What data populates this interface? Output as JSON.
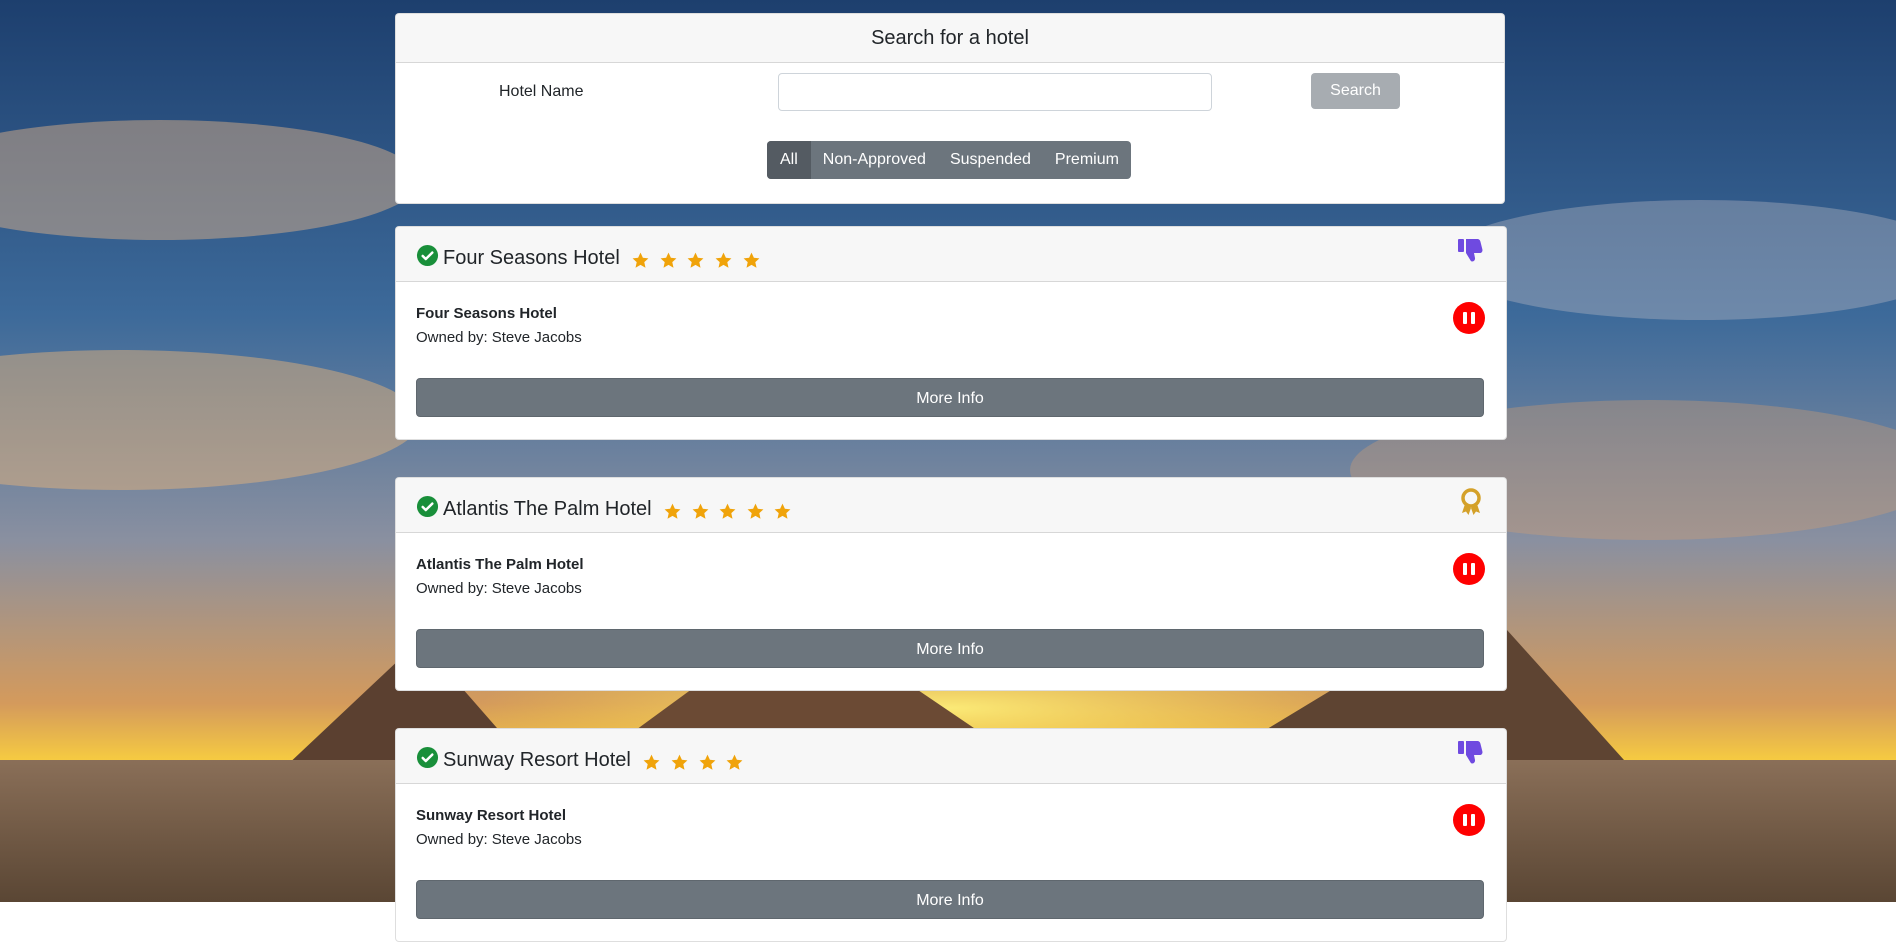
{
  "search": {
    "title": "Search for a hotel",
    "hotel_name_label": "Hotel Name",
    "hotel_name_value": "",
    "hotel_name_placeholder": "",
    "search_button": "Search",
    "filters": [
      "All",
      "Non-Approved",
      "Suspended",
      "Premium"
    ],
    "active_filter": "All"
  },
  "hotels": [
    {
      "title": "Four Seasons Hotel",
      "stars": 5,
      "approved": true,
      "badge": "thumbs-down-icon",
      "name": "Four Seasons Hotel",
      "owned_by_label": "Owned by:",
      "owner": "Steve Jacobs",
      "more_info": "More Info"
    },
    {
      "title": "Atlantis The Palm Hotel",
      "stars": 5,
      "approved": true,
      "badge": "premium-ribbon-icon",
      "name": "Atlantis The Palm Hotel",
      "owned_by_label": "Owned by:",
      "owner": "Steve Jacobs",
      "more_info": "More Info"
    },
    {
      "title": "Sunway Resort Hotel",
      "stars": 4,
      "approved": true,
      "badge": "thumbs-down-icon",
      "name": "Sunway Resort Hotel",
      "owned_by_label": "Owned by:",
      "owner": "Steve Jacobs",
      "more_info": "More Info"
    }
  ],
  "colors": {
    "check": "#198f3a",
    "star": "#f0a30a",
    "thumbs_down": "#6f4ae0",
    "ribbon": "#d4a12a",
    "pause": "#ff0000",
    "button_gray": "#6c757d"
  }
}
